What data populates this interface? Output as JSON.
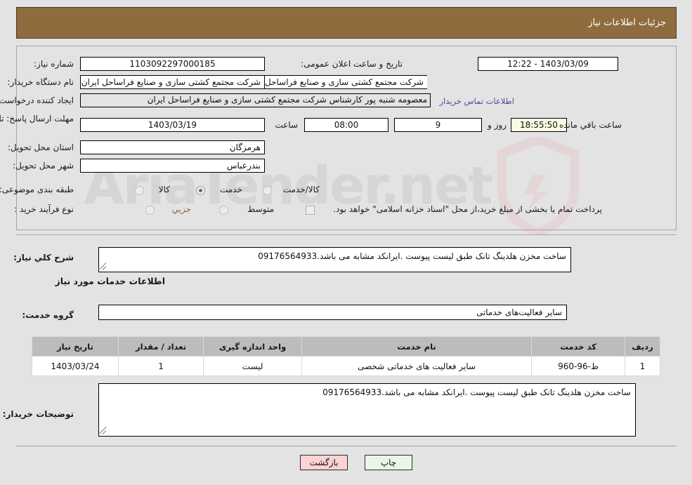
{
  "header": {
    "title": "جزئیات اطلاعات نیاز"
  },
  "watermark": {
    "text": "AriaTender.net",
    "logo_icon": "shield-icon"
  },
  "form": {
    "need_number_label": "شماره نیاز:",
    "need_number_value": "1103092297000185",
    "public_announce_label": "تاریخ و ساعت اعلان عمومی:",
    "public_announce_value": "1403/03/09 - 12:22",
    "buyer_org_label": "نام دستگاه خریدار:",
    "buyer_org_value": "شرکت مجتمع کشتی سازی و صنایع فراساحل ایران",
    "buyer_org_value_secondary": "شرکت مجتمع کشتی سازی و صنایع فراساحل ایران",
    "creator_label": "ایجاد کننده درخواست:",
    "creator_value": "معصومه شنبه پور کارشناس شرکت مجتمع کشتی سازی و صنایع فراساحل ایران",
    "creator_value_boxed": "شرکت مجتمع کشتی سازی و صنایع فراساحل ایرا",
    "contact_link": "اطلاعات تماس خریدار",
    "deadline_label": "مهلت ارسال پاسخ: تا تاریخ:",
    "deadline_date": "1403/03/19",
    "time_label": "ساعت",
    "time_value": "08:00",
    "days_value": "9",
    "days_unit_label": "روز و",
    "countdown_value": "18:55:50",
    "countdown_suffix_label": "ساعت باقي مانده",
    "province_label": "استان محل تحویل:",
    "province_value": "هرمزگان",
    "city_label": "شهر محل تحویل:",
    "city_value": "بندرعباس",
    "category_label": "طبقه بندی موضوعی:",
    "category_options": [
      "کالا",
      "خدمت",
      "کالا/خدمت"
    ],
    "category_selected": "خدمت",
    "process_label": "نوع فرآیند خرید :",
    "process_options": [
      "جزیي",
      "متوسط"
    ],
    "process_selected": "جزیي",
    "treasury_note": "پرداخت تمام یا بخشی از مبلغ خرید،از محل \"اسناد خزانه اسلامی\" خواهد بود."
  },
  "need_summary": {
    "label": "شرح کلي نیاز:",
    "value": "ساخت مخزن هلدینگ تانک طبق لیست پیوست .ایرانکد مشابه می باشد.09176564933"
  },
  "services_section": {
    "heading": "اطلاعات خدمات مورد نیاز",
    "group_label": "گروه خدمت:",
    "group_value": "سایر فعالیت‌های خدماتی",
    "table": {
      "columns": [
        "ردیف",
        "کد خدمت",
        "نام خدمت",
        "واحد اندازه گیری",
        "تعداد / مقدار",
        "تاریخ نیاز"
      ],
      "rows": [
        {
          "row_no": "1",
          "service_code": "ط-96-960",
          "service_name": "سایر فعالیت های خدماتی شخصی",
          "unit": "لیست",
          "quantity": "1",
          "need_date": "1403/03/24"
        }
      ]
    }
  },
  "buyer_notes": {
    "label": "توضیحات خریدار:",
    "value": "ساخت مخزن هلدینگ تانک طبق لیست پیوست .ایرانکد مشابه می باشد.09176564933"
  },
  "footer": {
    "print_label": "چاپ",
    "back_label": "بازگشت"
  }
}
